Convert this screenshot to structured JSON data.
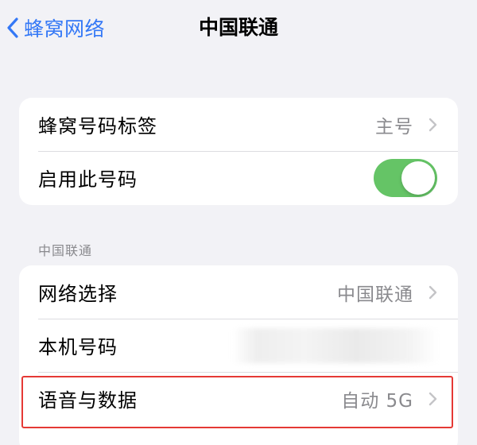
{
  "nav": {
    "back_label": "蜂窝网络",
    "title": "中国联通"
  },
  "group1": {
    "rows": [
      {
        "label": "蜂窝号码标签",
        "value": "主号"
      },
      {
        "label": "启用此号码",
        "toggle_on": true
      }
    ]
  },
  "section": {
    "header": "中国联通"
  },
  "group2": {
    "rows": [
      {
        "label": "网络选择",
        "value": "中国联通"
      },
      {
        "label": "本机号码"
      },
      {
        "label": "语音与数据",
        "value": "自动 5G"
      }
    ]
  },
  "colors": {
    "accent": "#3478f6",
    "toggle_on": "#65c466",
    "highlight": "#e53935",
    "background": "#f2f2f6"
  },
  "icons": {
    "back": "chevron-left-icon",
    "row_disclosure": "chevron-right-icon"
  }
}
